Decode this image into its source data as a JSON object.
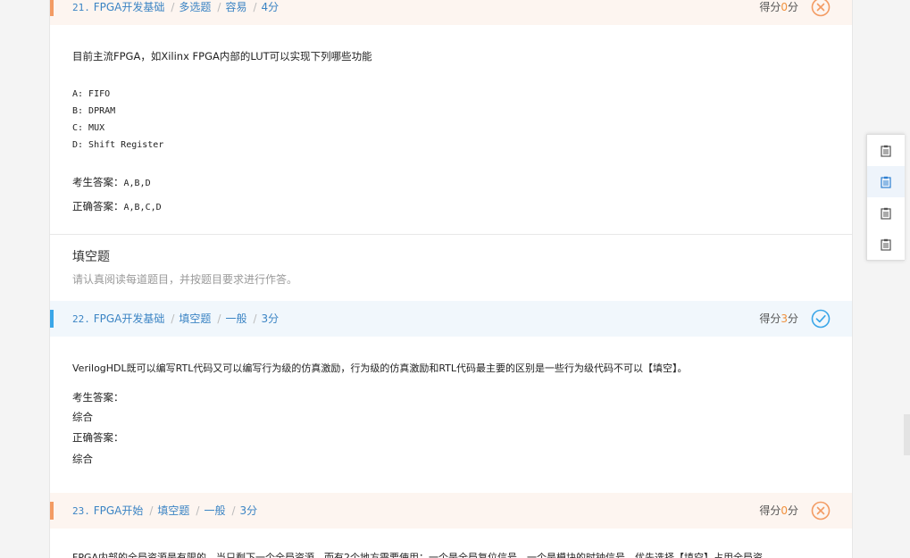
{
  "q21": {
    "num": "21.",
    "category": "FPGA开发基础",
    "type": "多选题",
    "difficulty": "容易",
    "points": "4分",
    "score_label": "得分",
    "score_value": "0",
    "score_unit": "分",
    "status": "wrong",
    "question": "目前主流FPGA，如Xilinx FPGA内部的LUT可以实现下列哪些功能",
    "options": [
      "A: FIFO",
      "B: DPRAM",
      "C: MUX",
      "D: Shift Register"
    ],
    "student_answer_label": "考生答案：",
    "student_answer": "A,B,D",
    "correct_answer_label": "正确答案：",
    "correct_answer": "A,B,C,D"
  },
  "section": {
    "title": "填空题",
    "desc": "请认真阅读每道题目，并按题目要求进行作答。"
  },
  "q22": {
    "num": "22.",
    "category": "FPGA开发基础",
    "type": "填空题",
    "difficulty": "一般",
    "points": "3分",
    "score_label": "得分",
    "score_value": "3",
    "score_unit": "分",
    "status": "correct",
    "question": "VerilogHDL既可以编写RTL代码又可以编写行为级的仿真激励，行为级的仿真激励和RTL代码最主要的区别是一些行为级代码不可以【填空】。",
    "student_answer_label": "考生答案：",
    "student_answer": "综合",
    "correct_answer_label": "正确答案：",
    "correct_answer": "综合"
  },
  "q23": {
    "num": "23.",
    "category": "FPGA开始",
    "type": "填空题",
    "difficulty": "一般",
    "points": "3分",
    "score_label": "得分",
    "score_value": "0",
    "score_unit": "分",
    "status": "wrong",
    "question": "FPGA内部的全局资源是有限的，当只剩下一个全局资源，而有2个地方需要使用：一个是全局复位信号，一个是模块的时钟信号，优先选择【填空】占用全局资"
  },
  "colors": {
    "accent_blue": "#3aa6e8",
    "accent_orange": "#f39b63",
    "link_blue": "#3b84c4"
  },
  "sidenav": {
    "items": [
      "clipboard-icon",
      "clipboard-icon",
      "clipboard-icon",
      "clipboard-icon"
    ],
    "active_index": 1
  }
}
